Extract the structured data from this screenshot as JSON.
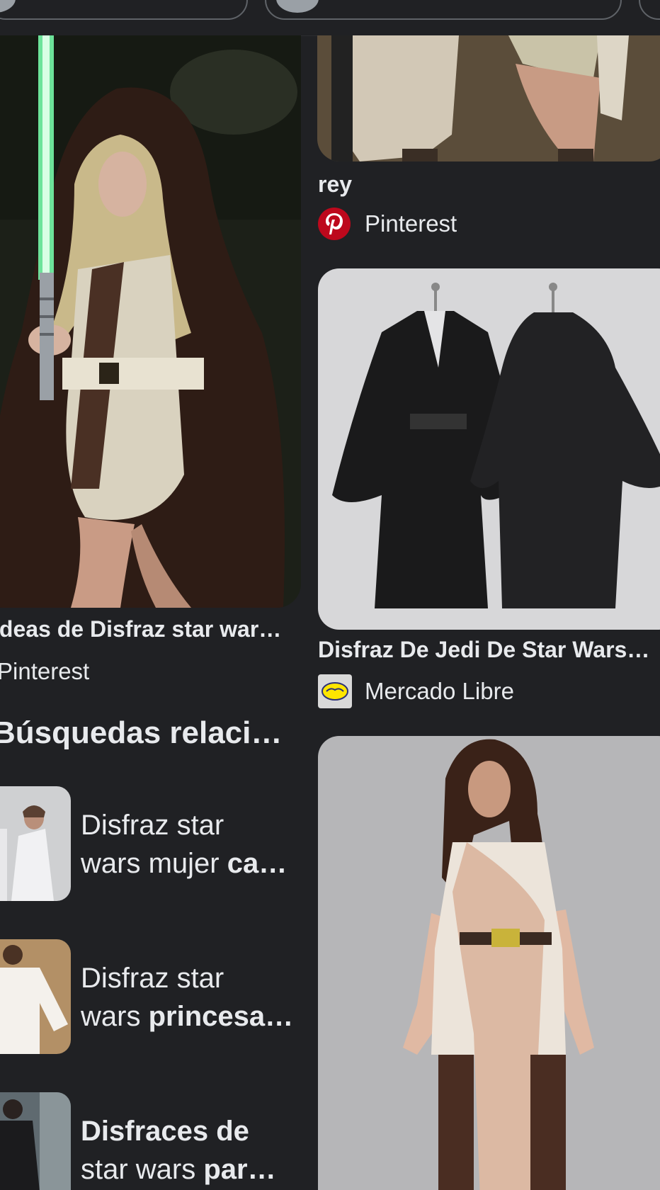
{
  "results": [
    {
      "title": "Ideas de Disfraz star war…",
      "source": "Pinterest",
      "image_label": "Mujer con capa marrón con capucha y sable de luz verde"
    },
    {
      "title": "rey",
      "source": "Pinterest",
      "image_label": "Piernas con vestuario beige"
    },
    {
      "title": "Disfraz De Jedi De Star Wars…",
      "source": "Mercado Libre",
      "image_label": "Dos túnicas jedi negras en maniquíes"
    },
    {
      "title": "",
      "source": "",
      "image_label": "Mujer con disfraz jedi beige"
    }
  ],
  "related": {
    "heading": "Búsquedas relaciona…",
    "items": [
      {
        "line1_normal": "Disfraz star",
        "line1_bold": "",
        "line2_normal": "wars mujer ",
        "line2_bold": "ca…"
      },
      {
        "line1_normal": "Disfraz star",
        "line1_bold": "",
        "line2_normal": "wars ",
        "line2_bold": "princesa…"
      },
      {
        "line1_normal": "",
        "line1_bold": "Disfraces de",
        "line2_normal": "star wars ",
        "line2_bold": "par…"
      }
    ]
  },
  "colors": {
    "background": "#202124",
    "text": "#e8eaed",
    "pinterest": "#bd081c"
  }
}
